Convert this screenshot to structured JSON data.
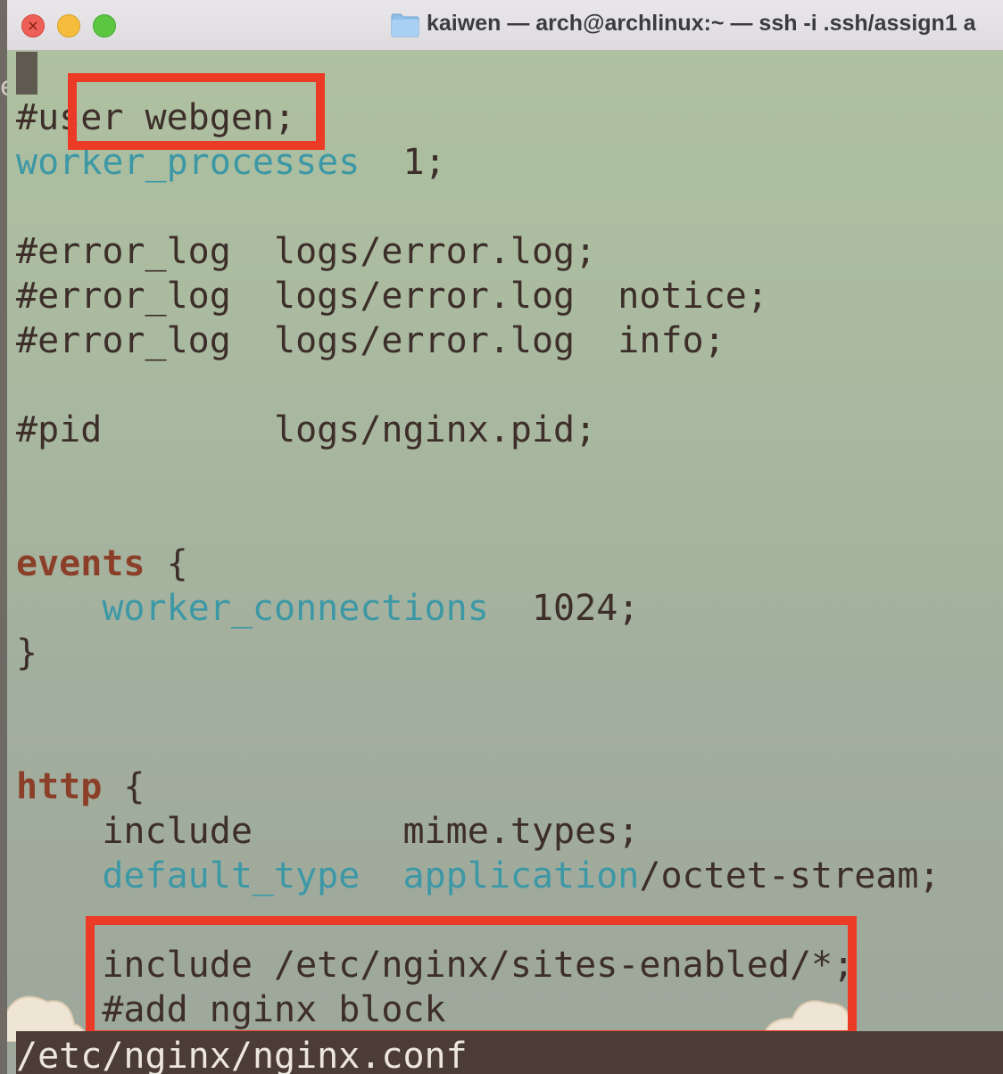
{
  "titlebar": {
    "title": "kaiwen — arch@archlinux:~ — ssh -i .ssh/assign1 a",
    "close_glyph": "×"
  },
  "editor": {
    "lines": {
      "l1": {
        "comment_prefix": "#us",
        "text": "er webgen;"
      },
      "l2": {
        "directive": "worker_processes",
        "value": "  1;"
      },
      "l3": {
        "text": "#error_log  logs/error.log;"
      },
      "l4": {
        "text": "#error_log  logs/error.log  notice;"
      },
      "l5": {
        "text": "#error_log  logs/error.log  info;"
      },
      "l6": {
        "text": "#pid        logs/nginx.pid;"
      },
      "l7": {
        "block": "events",
        "rest": " {"
      },
      "l8": {
        "indent": "    ",
        "directive": "worker_connections",
        "value": "  1024;"
      },
      "l9": {
        "text": "}"
      },
      "l10": {
        "block": "http",
        "rest": " {"
      },
      "l11": {
        "text": "    include       mime.types;"
      },
      "l12": {
        "indent": "    ",
        "directive": "default_type",
        "sep": "  ",
        "value_kw": "application",
        "value_rest": "/octet-stream;"
      },
      "l13": {
        "text": "    include /etc/nginx/sites-enabled/*;"
      },
      "l14": {
        "text": "    #add nginx block"
      }
    }
  },
  "statusbar": {
    "filename": "/etc/nginx/nginx.conf"
  },
  "colors": {
    "highlight_box": "#eb3b26",
    "keyword": "#3d98a6",
    "block": "#8b3f28",
    "text": "#3d2e2a",
    "statusbar_bg": "#4c3c38"
  },
  "icons": {
    "folder": "folder-icon"
  }
}
